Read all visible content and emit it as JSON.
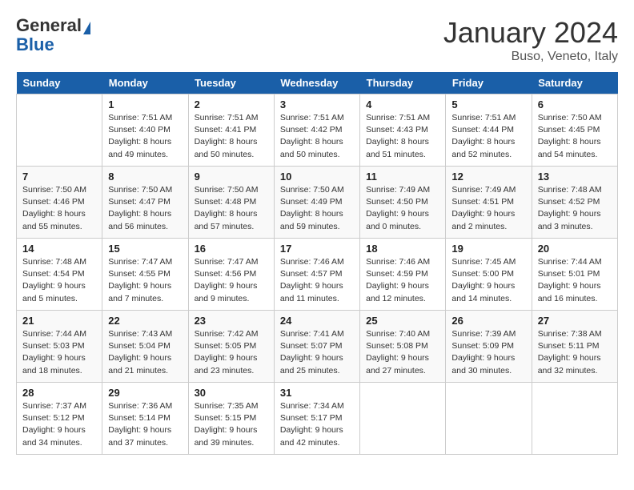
{
  "header": {
    "logo_general": "General",
    "logo_blue": "Blue",
    "month_year": "January 2024",
    "location": "Buso, Veneto, Italy"
  },
  "days_of_week": [
    "Sunday",
    "Monday",
    "Tuesday",
    "Wednesday",
    "Thursday",
    "Friday",
    "Saturday"
  ],
  "weeks": [
    [
      {
        "day": "",
        "sunrise": "",
        "sunset": "",
        "daylight": ""
      },
      {
        "day": "1",
        "sunrise": "Sunrise: 7:51 AM",
        "sunset": "Sunset: 4:40 PM",
        "daylight": "Daylight: 8 hours and 49 minutes."
      },
      {
        "day": "2",
        "sunrise": "Sunrise: 7:51 AM",
        "sunset": "Sunset: 4:41 PM",
        "daylight": "Daylight: 8 hours and 50 minutes."
      },
      {
        "day": "3",
        "sunrise": "Sunrise: 7:51 AM",
        "sunset": "Sunset: 4:42 PM",
        "daylight": "Daylight: 8 hours and 50 minutes."
      },
      {
        "day": "4",
        "sunrise": "Sunrise: 7:51 AM",
        "sunset": "Sunset: 4:43 PM",
        "daylight": "Daylight: 8 hours and 51 minutes."
      },
      {
        "day": "5",
        "sunrise": "Sunrise: 7:51 AM",
        "sunset": "Sunset: 4:44 PM",
        "daylight": "Daylight: 8 hours and 52 minutes."
      },
      {
        "day": "6",
        "sunrise": "Sunrise: 7:50 AM",
        "sunset": "Sunset: 4:45 PM",
        "daylight": "Daylight: 8 hours and 54 minutes."
      }
    ],
    [
      {
        "day": "7",
        "sunrise": "Sunrise: 7:50 AM",
        "sunset": "Sunset: 4:46 PM",
        "daylight": "Daylight: 8 hours and 55 minutes."
      },
      {
        "day": "8",
        "sunrise": "Sunrise: 7:50 AM",
        "sunset": "Sunset: 4:47 PM",
        "daylight": "Daylight: 8 hours and 56 minutes."
      },
      {
        "day": "9",
        "sunrise": "Sunrise: 7:50 AM",
        "sunset": "Sunset: 4:48 PM",
        "daylight": "Daylight: 8 hours and 57 minutes."
      },
      {
        "day": "10",
        "sunrise": "Sunrise: 7:50 AM",
        "sunset": "Sunset: 4:49 PM",
        "daylight": "Daylight: 8 hours and 59 minutes."
      },
      {
        "day": "11",
        "sunrise": "Sunrise: 7:49 AM",
        "sunset": "Sunset: 4:50 PM",
        "daylight": "Daylight: 9 hours and 0 minutes."
      },
      {
        "day": "12",
        "sunrise": "Sunrise: 7:49 AM",
        "sunset": "Sunset: 4:51 PM",
        "daylight": "Daylight: 9 hours and 2 minutes."
      },
      {
        "day": "13",
        "sunrise": "Sunrise: 7:48 AM",
        "sunset": "Sunset: 4:52 PM",
        "daylight": "Daylight: 9 hours and 3 minutes."
      }
    ],
    [
      {
        "day": "14",
        "sunrise": "Sunrise: 7:48 AM",
        "sunset": "Sunset: 4:54 PM",
        "daylight": "Daylight: 9 hours and 5 minutes."
      },
      {
        "day": "15",
        "sunrise": "Sunrise: 7:47 AM",
        "sunset": "Sunset: 4:55 PM",
        "daylight": "Daylight: 9 hours and 7 minutes."
      },
      {
        "day": "16",
        "sunrise": "Sunrise: 7:47 AM",
        "sunset": "Sunset: 4:56 PM",
        "daylight": "Daylight: 9 hours and 9 minutes."
      },
      {
        "day": "17",
        "sunrise": "Sunrise: 7:46 AM",
        "sunset": "Sunset: 4:57 PM",
        "daylight": "Daylight: 9 hours and 11 minutes."
      },
      {
        "day": "18",
        "sunrise": "Sunrise: 7:46 AM",
        "sunset": "Sunset: 4:59 PM",
        "daylight": "Daylight: 9 hours and 12 minutes."
      },
      {
        "day": "19",
        "sunrise": "Sunrise: 7:45 AM",
        "sunset": "Sunset: 5:00 PM",
        "daylight": "Daylight: 9 hours and 14 minutes."
      },
      {
        "day": "20",
        "sunrise": "Sunrise: 7:44 AM",
        "sunset": "Sunset: 5:01 PM",
        "daylight": "Daylight: 9 hours and 16 minutes."
      }
    ],
    [
      {
        "day": "21",
        "sunrise": "Sunrise: 7:44 AM",
        "sunset": "Sunset: 5:03 PM",
        "daylight": "Daylight: 9 hours and 18 minutes."
      },
      {
        "day": "22",
        "sunrise": "Sunrise: 7:43 AM",
        "sunset": "Sunset: 5:04 PM",
        "daylight": "Daylight: 9 hours and 21 minutes."
      },
      {
        "day": "23",
        "sunrise": "Sunrise: 7:42 AM",
        "sunset": "Sunset: 5:05 PM",
        "daylight": "Daylight: 9 hours and 23 minutes."
      },
      {
        "day": "24",
        "sunrise": "Sunrise: 7:41 AM",
        "sunset": "Sunset: 5:07 PM",
        "daylight": "Daylight: 9 hours and 25 minutes."
      },
      {
        "day": "25",
        "sunrise": "Sunrise: 7:40 AM",
        "sunset": "Sunset: 5:08 PM",
        "daylight": "Daylight: 9 hours and 27 minutes."
      },
      {
        "day": "26",
        "sunrise": "Sunrise: 7:39 AM",
        "sunset": "Sunset: 5:09 PM",
        "daylight": "Daylight: 9 hours and 30 minutes."
      },
      {
        "day": "27",
        "sunrise": "Sunrise: 7:38 AM",
        "sunset": "Sunset: 5:11 PM",
        "daylight": "Daylight: 9 hours and 32 minutes."
      }
    ],
    [
      {
        "day": "28",
        "sunrise": "Sunrise: 7:37 AM",
        "sunset": "Sunset: 5:12 PM",
        "daylight": "Daylight: 9 hours and 34 minutes."
      },
      {
        "day": "29",
        "sunrise": "Sunrise: 7:36 AM",
        "sunset": "Sunset: 5:14 PM",
        "daylight": "Daylight: 9 hours and 37 minutes."
      },
      {
        "day": "30",
        "sunrise": "Sunrise: 7:35 AM",
        "sunset": "Sunset: 5:15 PM",
        "daylight": "Daylight: 9 hours and 39 minutes."
      },
      {
        "day": "31",
        "sunrise": "Sunrise: 7:34 AM",
        "sunset": "Sunset: 5:17 PM",
        "daylight": "Daylight: 9 hours and 42 minutes."
      },
      {
        "day": "",
        "sunrise": "",
        "sunset": "",
        "daylight": ""
      },
      {
        "day": "",
        "sunrise": "",
        "sunset": "",
        "daylight": ""
      },
      {
        "day": "",
        "sunrise": "",
        "sunset": "",
        "daylight": ""
      }
    ]
  ]
}
